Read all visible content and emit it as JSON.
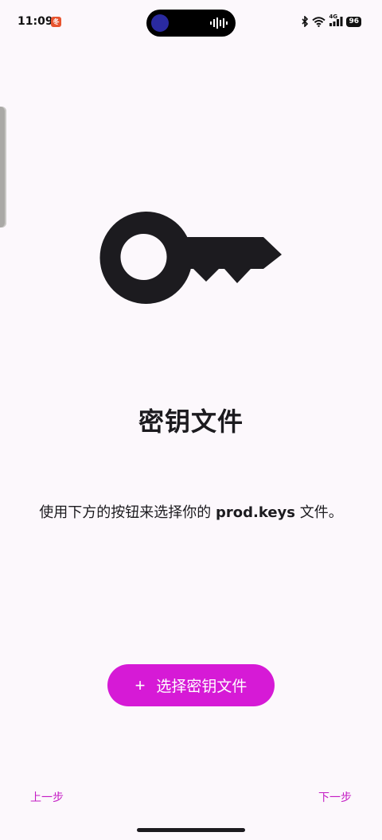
{
  "status_bar": {
    "time": "11:09",
    "notification_badge": "冬",
    "signal_label": "4G",
    "battery": "96"
  },
  "icons": {
    "illustration": "key-icon",
    "add": "plus-icon"
  },
  "main": {
    "title": "密钥文件",
    "description_prefix": "使用下方的按钮来选择你的 ",
    "description_bold": "prod.keys",
    "description_suffix": " 文件。",
    "select_button_plus": "+",
    "select_button_label": "选择密钥文件"
  },
  "navigation": {
    "prev_label": "上一步",
    "next_label": "下一步"
  },
  "colors": {
    "background": "#fcf8fc",
    "accent": "#d61ad6",
    "nav_text": "#c41cc4",
    "text": "#1c1b1f"
  }
}
